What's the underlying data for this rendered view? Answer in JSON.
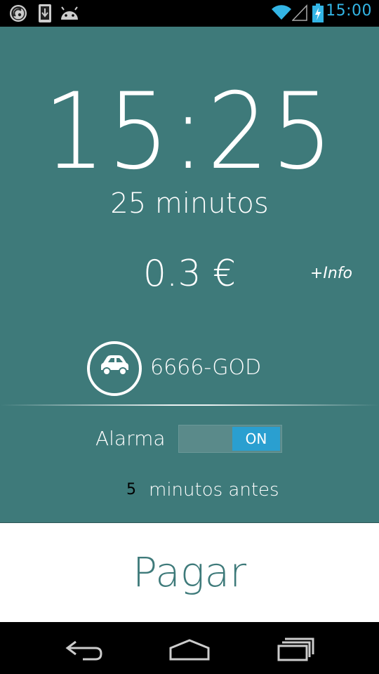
{
  "status_bar": {
    "time": "15:00",
    "icons": [
      "wireless-tether-icon",
      "download-icon",
      "android-icon",
      "wifi-icon",
      "signal-icon",
      "battery-charging-icon"
    ],
    "accent_color": "#33b5e5"
  },
  "parking": {
    "end_time": "15:25",
    "duration": "25 minutos",
    "price": "0.3 €",
    "info_link": "+Info",
    "plate": "6666-GOD",
    "vehicle_icon": "car-icon"
  },
  "alarm": {
    "label": "Alarma",
    "toggle_state": "ON",
    "minutes_before_value": "5",
    "minutes_before_label": "minutos antes"
  },
  "pay_button": {
    "label": "Pagar"
  },
  "nav_bar": {
    "icons": [
      "back-icon",
      "home-icon",
      "recents-icon"
    ]
  },
  "colors": {
    "background": "#3e7a7a",
    "toggle_on": "#2a9fd0"
  }
}
